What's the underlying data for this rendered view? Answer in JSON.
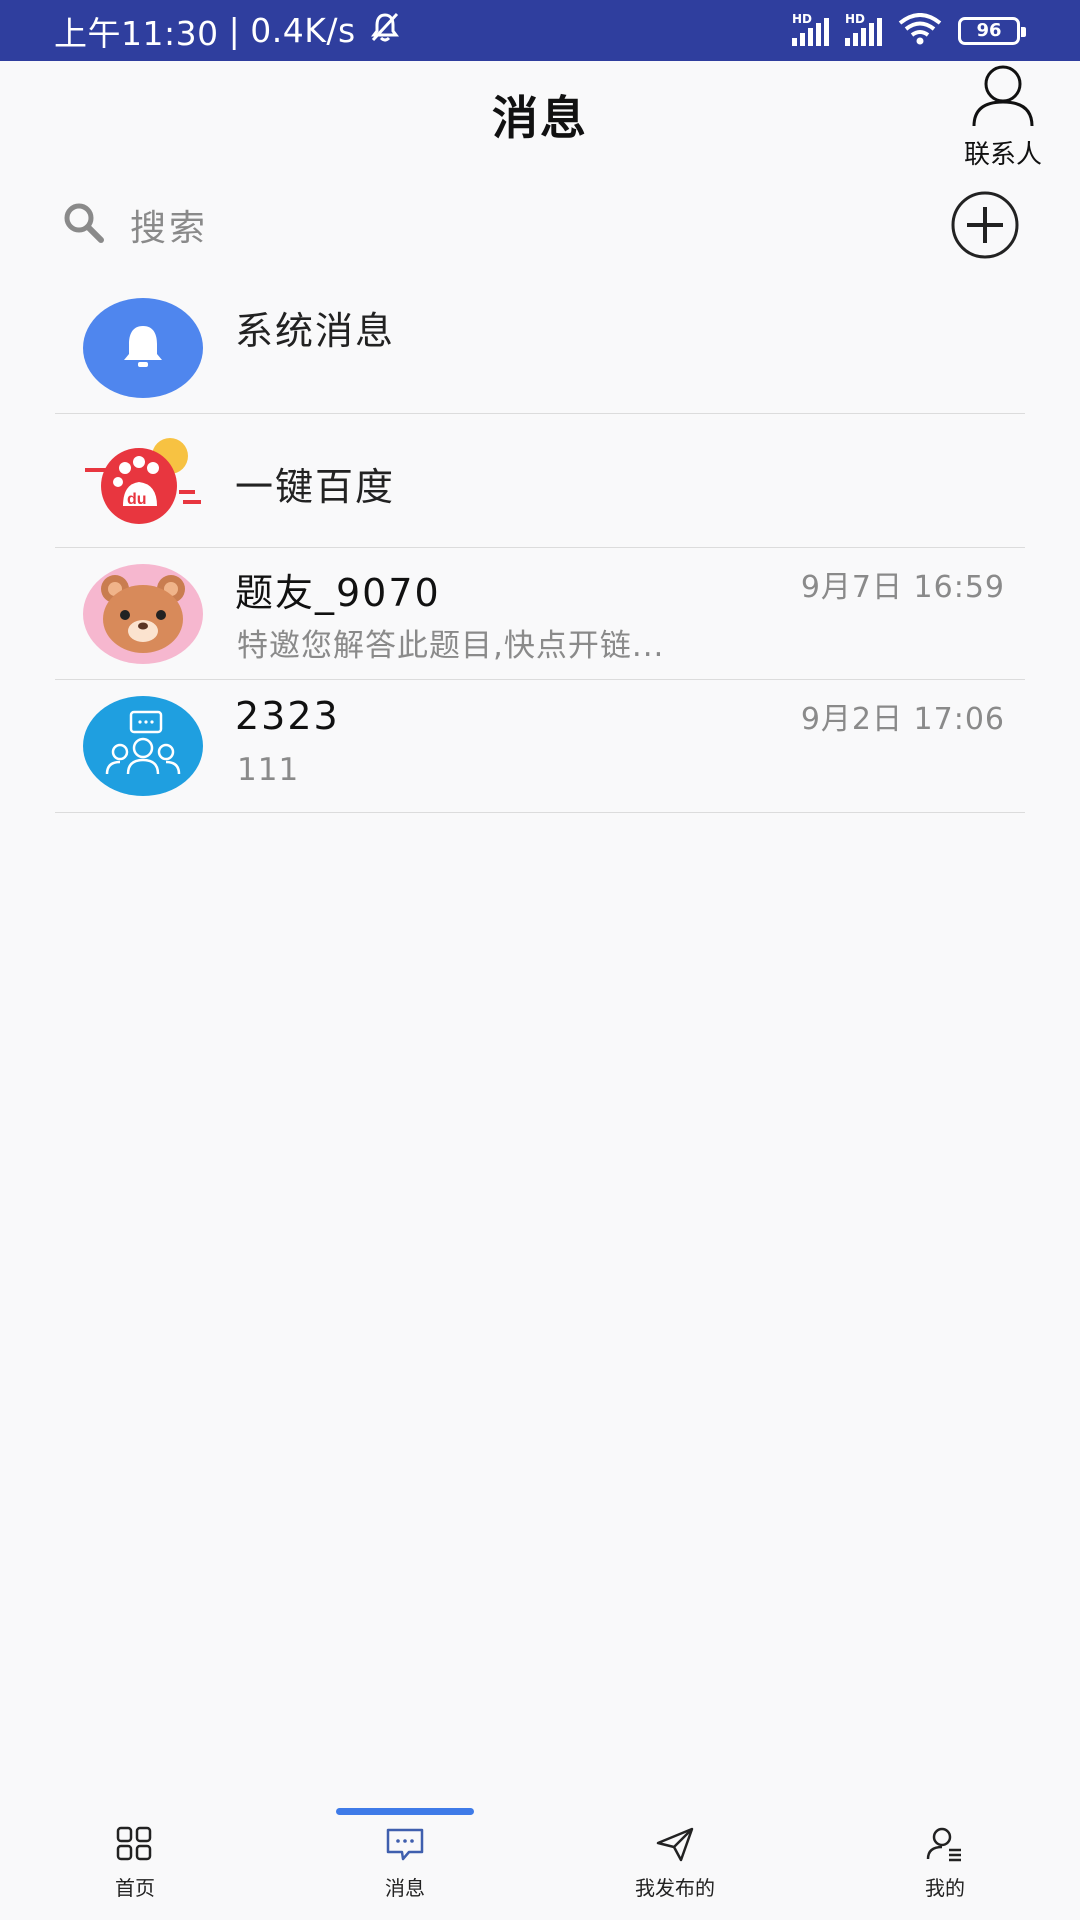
{
  "status_bar": {
    "time": "上午11:30",
    "network_speed": "0.4K/s",
    "battery": "96",
    "signal_label": "HD"
  },
  "header": {
    "title": "消息",
    "contacts_label": "联系人"
  },
  "search": {
    "placeholder": "搜索"
  },
  "conversations": [
    {
      "name": "系统消息",
      "time": "",
      "preview": "",
      "avatar": "bell-avatar"
    },
    {
      "name": "一键百度",
      "time": "",
      "preview": "",
      "avatar": "baidu-avatar"
    },
    {
      "name": "题友_9070",
      "time": "9月7日 16:59",
      "preview": "特邀您解答此题目,快点开链...",
      "avatar": "bear-avatar"
    },
    {
      "name": "2323",
      "time": "9月2日 17:06",
      "preview": "111",
      "avatar": "group-avatar"
    }
  ],
  "bottom_nav": [
    {
      "label": "首页",
      "icon": "grid-icon",
      "active": false
    },
    {
      "label": "消息",
      "icon": "message-icon",
      "active": true
    },
    {
      "label": "我发布的",
      "icon": "send-icon",
      "active": false
    },
    {
      "label": "我的",
      "icon": "profile-icon",
      "active": false
    }
  ],
  "colors": {
    "status_bar": "#2f3e9e",
    "accent": "#3f7be8",
    "bell_avatar": "#4f86ee",
    "baidu_red": "#e8363f",
    "bear_pink": "#f6b7cf",
    "group_blue": "#1f9fe0"
  }
}
